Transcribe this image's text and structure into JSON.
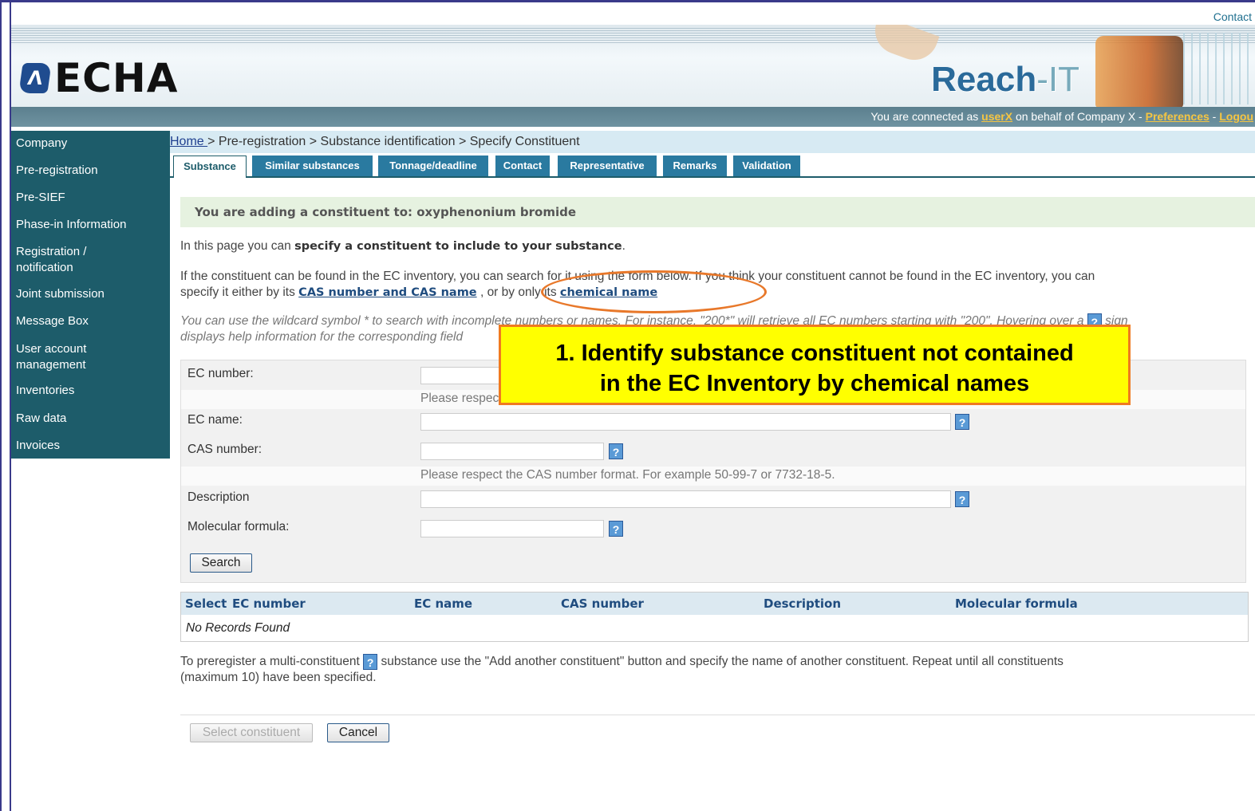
{
  "header": {
    "contact": "Contact",
    "logo_text": "ECHA",
    "logo_mark": "Λ",
    "product": "Reach",
    "product_suffix": "-IT",
    "connected_prefix": "You are connected as",
    "user": "userX",
    "connected_middle": "on behalf of Company X -",
    "preferences": "Preferences",
    "sep": "-",
    "logout": "Logou"
  },
  "sidebar": {
    "items": [
      {
        "label": "Company"
      },
      {
        "label": "Pre-registration"
      },
      {
        "label": "Pre-SIEF"
      },
      {
        "label": "Phase-in Information"
      },
      {
        "label": "Registration / notification"
      },
      {
        "label": "Joint submission"
      },
      {
        "label": "Message Box"
      },
      {
        "label": "User account management"
      },
      {
        "label": "Inventories"
      },
      {
        "label": "Raw data"
      },
      {
        "label": "Invoices"
      }
    ]
  },
  "breadcrumb": {
    "home": "Home ",
    "rest": "> Pre-registration > Substance identification > Specify Constituent"
  },
  "tabs": [
    {
      "label": "Substance"
    },
    {
      "label": "Similar substances"
    },
    {
      "label": "Tonnage/deadline"
    },
    {
      "label": "Contact"
    },
    {
      "label": "Representative"
    },
    {
      "label": "Remarks"
    },
    {
      "label": "Validation"
    }
  ],
  "notice": "You are adding a constituent to: oxyphenonium bromide",
  "intro": {
    "prefix": "In this page you can",
    "bold": "specify a constituent to include to your substance",
    "suffix": "."
  },
  "info": {
    "line1": "If the constituent can be found in the EC inventory, you can search for it using the form below. If you think your constituent cannot be found in the EC inventory, you can",
    "line2_prefix": "specify it either by its",
    "link_cas": "CAS number and CAS name",
    "line2_middle": ", or by only its",
    "link_chem": "chemical name"
  },
  "wildcard": {
    "line1": "You can use the wildcard symbol * to search with incomplete numbers or names. For instance, \"200*\" will retrieve all EC numbers starting with \"200\". Hovering over a",
    "line1_end": "sign",
    "line2": "displays help information for the corresponding field"
  },
  "help_glyph": "?",
  "form": {
    "ec_number_label": "EC number:",
    "ec_hint": "Please respect the EC number format.",
    "ec_name_label": "EC name:",
    "cas_label": "CAS number:",
    "cas_hint": "Please respect the CAS number format. For example 50-99-7 or 7732-18-5.",
    "description_label": "Description",
    "formula_label": "Molecular formula:",
    "search_button": "Search"
  },
  "results": {
    "columns": [
      "Select",
      "EC number",
      "EC name",
      "CAS number",
      "Description",
      "Molecular formula"
    ],
    "empty": "No Records Found"
  },
  "multi": {
    "prefix": "To preregister a multi-constituent",
    "suffix": "substance use the \"Add another constituent\" button and specify the name of another constituent. Repeat until all constituents",
    "line2": "(maximum 10) have been specified."
  },
  "buttons": {
    "select_constituent": "Select constituent",
    "cancel": "Cancel"
  },
  "callout": {
    "line1": "1. Identify substance constituent not contained",
    "line2": "in the EC Inventory by chemical names"
  },
  "colors": {
    "sidebar": "#1d5c6a",
    "tab": "#2a7aa0",
    "callout_bg": "#ffff00",
    "callout_border": "#f07a20",
    "link": "#1f4c7f"
  }
}
